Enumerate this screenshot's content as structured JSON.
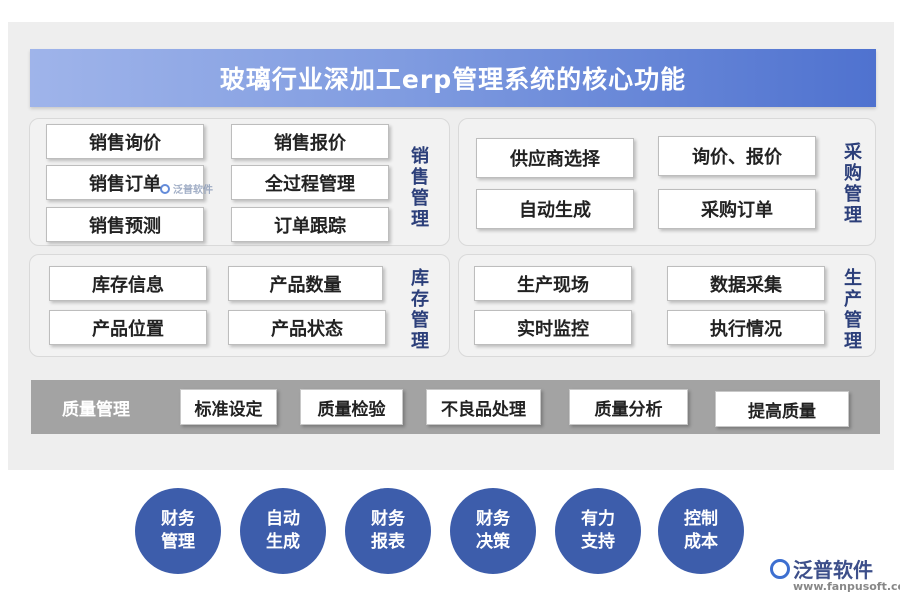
{
  "title": "玻璃行业深加工erp管理系统的核心功能",
  "sales": {
    "label": "销售管理",
    "items": [
      "销售询价",
      "销售报价",
      "销售订单",
      "全过程管理",
      "销售预测",
      "订单跟踪"
    ]
  },
  "purchase": {
    "label": "采购管理",
    "items": [
      "供应商选择",
      "询价、报价",
      "自动生成",
      "采购订单"
    ]
  },
  "inventory": {
    "label": "库存管理",
    "items": [
      "库存信息",
      "产品数量",
      "产品位置",
      "产品状态"
    ]
  },
  "production": {
    "label": "生产管理",
    "items": [
      "生产现场",
      "数据采集",
      "实时监控",
      "执行情况"
    ]
  },
  "quality": {
    "label": "质量管理",
    "items": [
      "标准设定",
      "质量检验",
      "不良品处理",
      "质量分析",
      "提高质量"
    ]
  },
  "circles": [
    {
      "line1": "财务",
      "line2": "管理"
    },
    {
      "line1": "自动",
      "line2": "生成"
    },
    {
      "line1": "财务",
      "line2": "报表"
    },
    {
      "line1": "财务",
      "line2": "决策"
    },
    {
      "line1": "有力",
      "line2": "支持"
    },
    {
      "line1": "控制",
      "line2": "成本"
    }
  ],
  "watermark": {
    "brand": "泛普软件",
    "url": "www.fanpusoft.com"
  },
  "colors": {
    "title_start": "#9fb4ea",
    "title_end": "#4f72cf",
    "circle": "#3d5dab",
    "vertical_label": "#2c3f7a",
    "quality_bar": "#a3a3a3"
  }
}
